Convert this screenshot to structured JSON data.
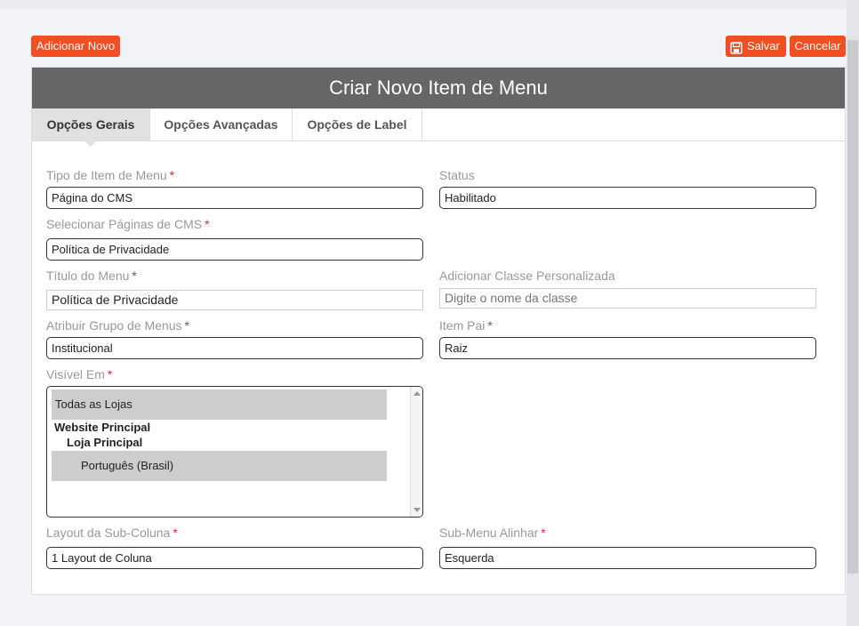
{
  "toolbar": {
    "add_label": "Adicionar Novo",
    "save_label": "Salvar",
    "cancel_label": "Cancelar"
  },
  "panel": {
    "title": "Criar Novo Item de Menu"
  },
  "tabs": [
    {
      "label": "Opções Gerais",
      "active": true
    },
    {
      "label": "Opções Avançadas",
      "active": false
    },
    {
      "label": "Opções de Label",
      "active": false
    }
  ],
  "form": {
    "menu_type": {
      "label": "Tipo de Item de Menu",
      "required": "*",
      "value": "Página do CMS"
    },
    "status": {
      "label": "Status",
      "value": "Habilitado"
    },
    "cms_pages": {
      "label": "Selecionar Páginas de CMS",
      "required": "*",
      "value": "Política de Privacidade"
    },
    "menu_title": {
      "label": "Título do Menu",
      "required": "*",
      "value": "Política de Privacidade"
    },
    "custom_class": {
      "label": "Adicionar Classe Personalizada",
      "placeholder": "Digite o nome da classe"
    },
    "menu_group": {
      "label": "Atribuir Grupo de Menus",
      "required": "*",
      "value": "Institucional"
    },
    "parent_item": {
      "label": "Item Pai",
      "required": "*",
      "value": "Raiz"
    },
    "visible_in": {
      "label": "Visível Em",
      "required": "*",
      "options": {
        "all_stores": "Todas as Lojas",
        "website": "Website Principal",
        "store": "Loja Principal",
        "store_view": "Português (Brasil)"
      }
    },
    "sub_column_layout": {
      "label": "Layout da Sub-Coluna",
      "required": "*",
      "value": "1 Layout de Coluna"
    },
    "submenu_align": {
      "label": "Sub-Menu Alinhar",
      "required": "*",
      "value": "Esquerda"
    }
  },
  "colors": {
    "accent": "#f04e23",
    "header": "#666666",
    "required": "#e02b27"
  }
}
